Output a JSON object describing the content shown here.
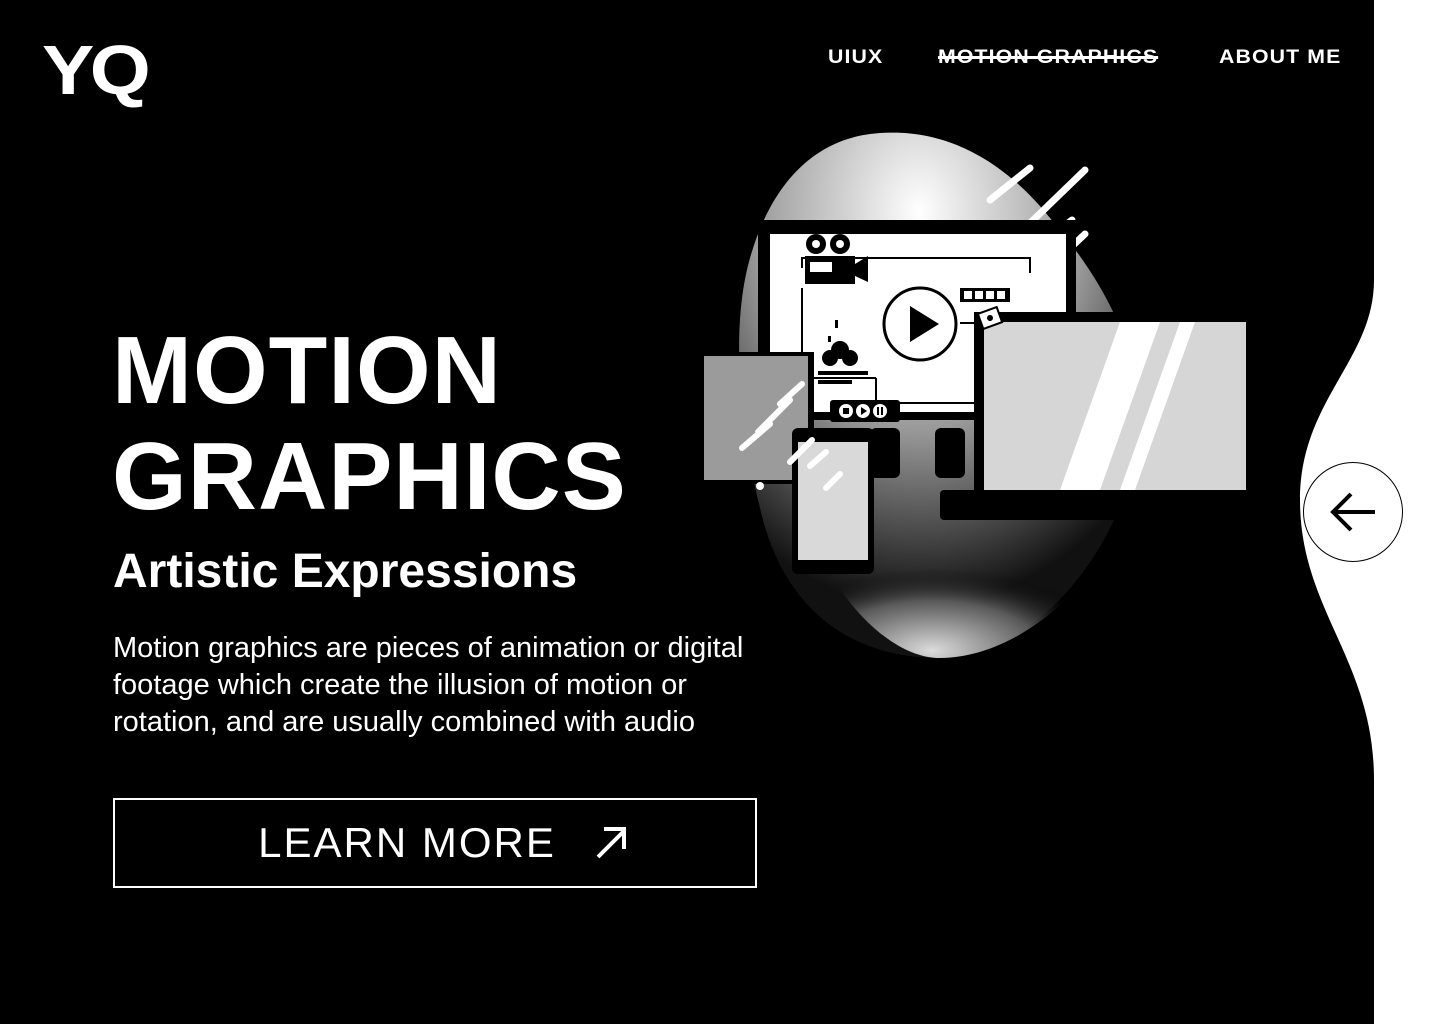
{
  "brand": {
    "logo": "YQ"
  },
  "nav": {
    "items": [
      {
        "label": "UIUX",
        "active": false
      },
      {
        "label": "MOTION GRAPHICS",
        "active": true
      },
      {
        "label": "ABOUT ME",
        "active": false
      }
    ]
  },
  "hero": {
    "title_line1": "MOTION",
    "title_line2": "GRAPHICS",
    "subtitle": "Artistic Expressions",
    "description": "Motion graphics are pieces of animation or digital footage which create the illusion of motion or rotation, and are usually combined with audio",
    "cta_label": "LEARN MORE",
    "cta_icon": "arrow-up-right-icon"
  },
  "back_button": {
    "icon": "arrow-left-icon"
  },
  "colors": {
    "background": "#000000",
    "foreground": "#ffffff",
    "right_panel": "#ffffff"
  }
}
